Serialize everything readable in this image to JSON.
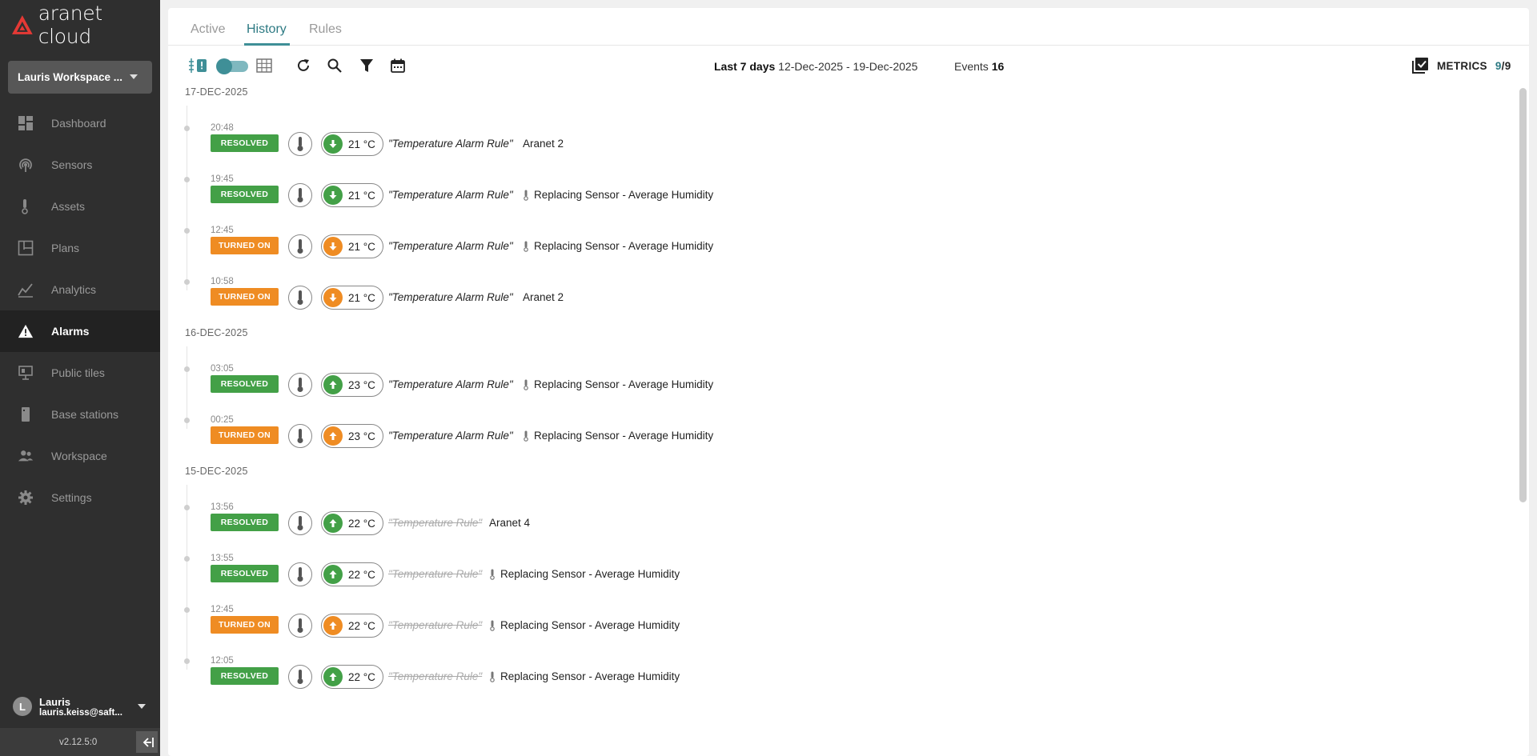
{
  "app": {
    "logo_text": "aranet cloud",
    "version": "v2.12.5:0"
  },
  "workspace": {
    "label": "Lauris Workspace ..."
  },
  "nav": [
    {
      "label": "Dashboard",
      "icon": "dashboard-icon"
    },
    {
      "label": "Sensors",
      "icon": "sensor-icon"
    },
    {
      "label": "Assets",
      "icon": "asset-icon"
    },
    {
      "label": "Plans",
      "icon": "plans-icon"
    },
    {
      "label": "Analytics",
      "icon": "analytics-icon"
    },
    {
      "label": "Alarms",
      "icon": "alarm-warning-icon",
      "active": true
    },
    {
      "label": "Public tiles",
      "icon": "public-tiles-icon"
    },
    {
      "label": "Base stations",
      "icon": "base-station-icon"
    },
    {
      "label": "Workspace",
      "icon": "users-icon"
    },
    {
      "label": "Settings",
      "icon": "gear-icon"
    }
  ],
  "user": {
    "initial": "L",
    "name": "Lauris",
    "email": "lauris.keiss@saft..."
  },
  "tabs": [
    {
      "label": "Active"
    },
    {
      "label": "History",
      "active": true
    },
    {
      "label": "Rules"
    }
  ],
  "toolbar": {
    "range_label": "Last 7 days",
    "range_value": "12-Dec-2025 - 19-Dec-2025",
    "events_label": "Events",
    "events_count": "16",
    "metrics_label": "METRICS",
    "metrics_selected": "9",
    "metrics_total": "/9"
  },
  "colors": {
    "accent": "#3f8f97",
    "resolved": "#43a047",
    "turned_on": "#ef8c23",
    "sidebar": "#2f2f2f"
  },
  "groups": [
    {
      "date": "17-DEC-2025",
      "events": [
        {
          "time": "20:48",
          "status": "RESOLVED",
          "kind": "resolved",
          "arrow": "down",
          "value": "21 °C",
          "rule": "\"Temperature Alarm Rule\"",
          "rule_deleted": false,
          "asset": "Aranet 2",
          "asset_icon": false
        },
        {
          "time": "19:45",
          "status": "RESOLVED",
          "kind": "resolved",
          "arrow": "down",
          "value": "21 °C",
          "rule": "\"Temperature Alarm Rule\"",
          "rule_deleted": false,
          "asset": "Replacing Sensor - Average Humidity",
          "asset_icon": true
        },
        {
          "time": "12:45",
          "status": "TURNED ON",
          "kind": "turnedon",
          "arrow": "down",
          "value": "21 °C",
          "rule": "\"Temperature Alarm Rule\"",
          "rule_deleted": false,
          "asset": "Replacing Sensor - Average Humidity",
          "asset_icon": true
        },
        {
          "time": "10:58",
          "status": "TURNED ON",
          "kind": "turnedon",
          "arrow": "down",
          "value": "21 °C",
          "rule": "\"Temperature Alarm Rule\"",
          "rule_deleted": false,
          "asset": "Aranet 2",
          "asset_icon": false
        }
      ]
    },
    {
      "date": "16-DEC-2025",
      "events": [
        {
          "time": "03:05",
          "status": "RESOLVED",
          "kind": "resolved",
          "arrow": "up",
          "value": "23 °C",
          "rule": "\"Temperature Alarm Rule\"",
          "rule_deleted": false,
          "asset": "Replacing Sensor - Average Humidity",
          "asset_icon": true
        },
        {
          "time": "00:25",
          "status": "TURNED ON",
          "kind": "turnedon",
          "arrow": "up",
          "value": "23 °C",
          "rule": "\"Temperature Alarm Rule\"",
          "rule_deleted": false,
          "asset": "Replacing Sensor - Average Humidity",
          "asset_icon": true
        }
      ]
    },
    {
      "date": "15-DEC-2025",
      "events": [
        {
          "time": "13:56",
          "status": "RESOLVED",
          "kind": "resolved",
          "arrow": "up",
          "value": "22 °C",
          "rule": "\"Temperature Rule\"",
          "rule_deleted": true,
          "asset": "Aranet 4",
          "asset_icon": false
        },
        {
          "time": "13:55",
          "status": "RESOLVED",
          "kind": "resolved",
          "arrow": "up",
          "value": "22 °C",
          "rule": "\"Temperature Rule\"",
          "rule_deleted": true,
          "asset": "Replacing Sensor - Average Humidity",
          "asset_icon": true
        },
        {
          "time": "12:45",
          "status": "TURNED ON",
          "kind": "turnedon",
          "arrow": "up",
          "value": "22 °C",
          "rule": "\"Temperature Rule\"",
          "rule_deleted": true,
          "asset": "Replacing Sensor - Average Humidity",
          "asset_icon": true
        },
        {
          "time": "12:05",
          "status": "RESOLVED",
          "kind": "resolved",
          "arrow": "up",
          "value": "22 °C",
          "rule": "\"Temperature Rule\"",
          "rule_deleted": true,
          "asset": "Replacing Sensor - Average Humidity",
          "asset_icon": true
        }
      ]
    }
  ]
}
